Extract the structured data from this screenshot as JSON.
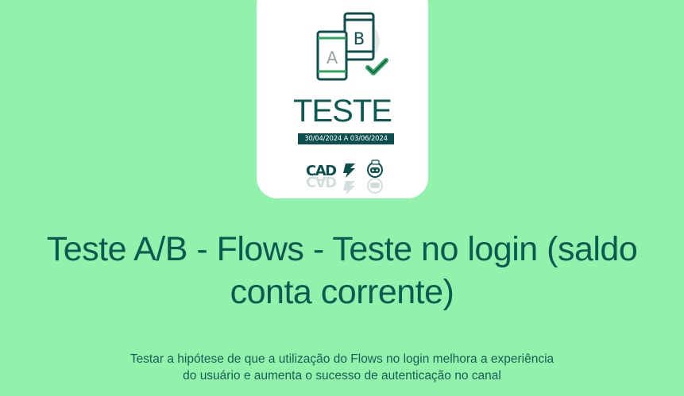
{
  "card": {
    "icon": "ab-test-phones-icon",
    "variant_a_label": "A",
    "variant_b_label": "B",
    "title": "TESTE",
    "date_range": "30/04/2024 A 03/06/2024",
    "logos": {
      "cad_label": "CAD",
      "bank_icon": "banco-do-brasil-icon",
      "bot_icon": "chatbot-icon"
    }
  },
  "headline": {
    "line1": "Teste A/B - Flows - Teste no login (saldo",
    "line2": "conta corrente)"
  },
  "description": {
    "line1": "Testar a hipótese de que a utilização do Flows no login melhora a experiência",
    "line2": "do usuário e aumenta o sucesso de autenticação no canal"
  },
  "colors": {
    "background": "#92f2ac",
    "primary": "#0a5a52",
    "badge": "#0c4f4d",
    "card": "#ffffff"
  }
}
